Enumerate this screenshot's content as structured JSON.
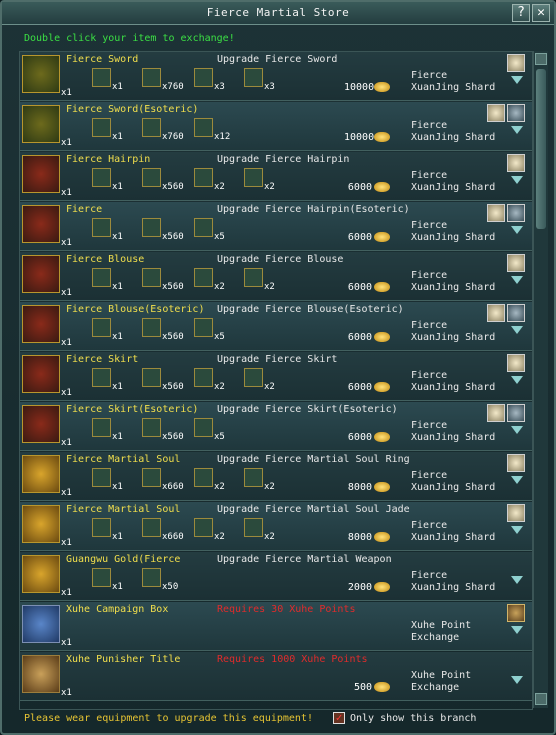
{
  "window": {
    "title": "Fierce Martial Store",
    "help_label": "?",
    "close_label": "✕"
  },
  "hint": "Double click your item to exchange!",
  "rows": [
    {
      "name": "Fierce Sword",
      "qty": "x1",
      "desc": "Upgrade Fierce Sword",
      "price": "10000",
      "mats": [
        "x1",
        "x760",
        "x3",
        "x3"
      ],
      "currency": "Fierce XuanJing Shard"
    },
    {
      "name": "Fierce Sword(Esoteric)",
      "qty": "x1",
      "desc": "",
      "price": "10000",
      "mats": [
        "x1",
        "x760",
        "x12"
      ],
      "currency": "Fierce XuanJing Shard"
    },
    {
      "name": "Fierce Hairpin",
      "qty": "x1",
      "desc": "Upgrade Fierce Hairpin",
      "price": "6000",
      "mats": [
        "x1",
        "x560",
        "x2",
        "x2"
      ],
      "currency": "Fierce XuanJing Shard"
    },
    {
      "name": "Fierce",
      "qty": "x1",
      "desc": "Upgrade Fierce Hairpin(Esoteric)",
      "price": "6000",
      "mats": [
        "x1",
        "x560",
        "x5"
      ],
      "currency": "Fierce XuanJing Shard"
    },
    {
      "name": "Fierce Blouse",
      "qty": "x1",
      "desc": "Upgrade Fierce Blouse",
      "price": "6000",
      "mats": [
        "x1",
        "x560",
        "x2",
        "x2"
      ],
      "currency": "Fierce XuanJing Shard"
    },
    {
      "name": "Fierce Blouse(Esoteric)",
      "qty": "x1",
      "desc": "Upgrade Fierce Blouse(Esoteric)",
      "price": "6000",
      "mats": [
        "x1",
        "x560",
        "x5"
      ],
      "currency": "Fierce XuanJing Shard"
    },
    {
      "name": "Fierce Skirt",
      "qty": "x1",
      "desc": "Upgrade Fierce Skirt",
      "price": "6000",
      "mats": [
        "x1",
        "x560",
        "x2",
        "x2"
      ],
      "currency": "Fierce XuanJing Shard"
    },
    {
      "name": "Fierce Skirt(Esoteric)",
      "qty": "x1",
      "desc": "Upgrade Fierce Skirt(Esoteric)",
      "price": "6000",
      "mats": [
        "x1",
        "x560",
        "x5"
      ],
      "currency": "Fierce XuanJing Shard"
    },
    {
      "name": "Fierce Martial Soul",
      "qty": "x1",
      "desc": "Upgrade Fierce Martial Soul Ring",
      "price": "8000",
      "mats": [
        "x1",
        "x660",
        "x2",
        "x2"
      ],
      "currency": "Fierce XuanJing Shard"
    },
    {
      "name": "Fierce Martial Soul",
      "qty": "x1",
      "desc": "Upgrade Fierce Martial Soul Jade",
      "price": "8000",
      "mats": [
        "x1",
        "x660",
        "x2",
        "x2"
      ],
      "currency": "Fierce XuanJing Shard"
    },
    {
      "name": "Guangwu Gold(Fierce",
      "qty": "x1",
      "desc": "Upgrade Fierce Martial Weapon",
      "price": "2000",
      "mats": [
        "x1",
        "x50"
      ],
      "currency": "Fierce XuanJing Shard"
    },
    {
      "name": "Xuhe Campaign Box",
      "qty": "x1",
      "req": "Requires 30 Xuhe Points",
      "price": "",
      "mats": [],
      "currency": "Xuhe Point Exchange"
    },
    {
      "name": "Xuhe Punisher Title",
      "qty": "x1",
      "req": "Requires 1000 Xuhe Points",
      "price": "500",
      "mats": [],
      "currency": "Xuhe Point Exchange"
    }
  ],
  "footer": {
    "warning": "Please wear equipment to upgrade this equipment!",
    "checkbox_mark": "✓",
    "checkbox_label": "Only show this branch"
  }
}
